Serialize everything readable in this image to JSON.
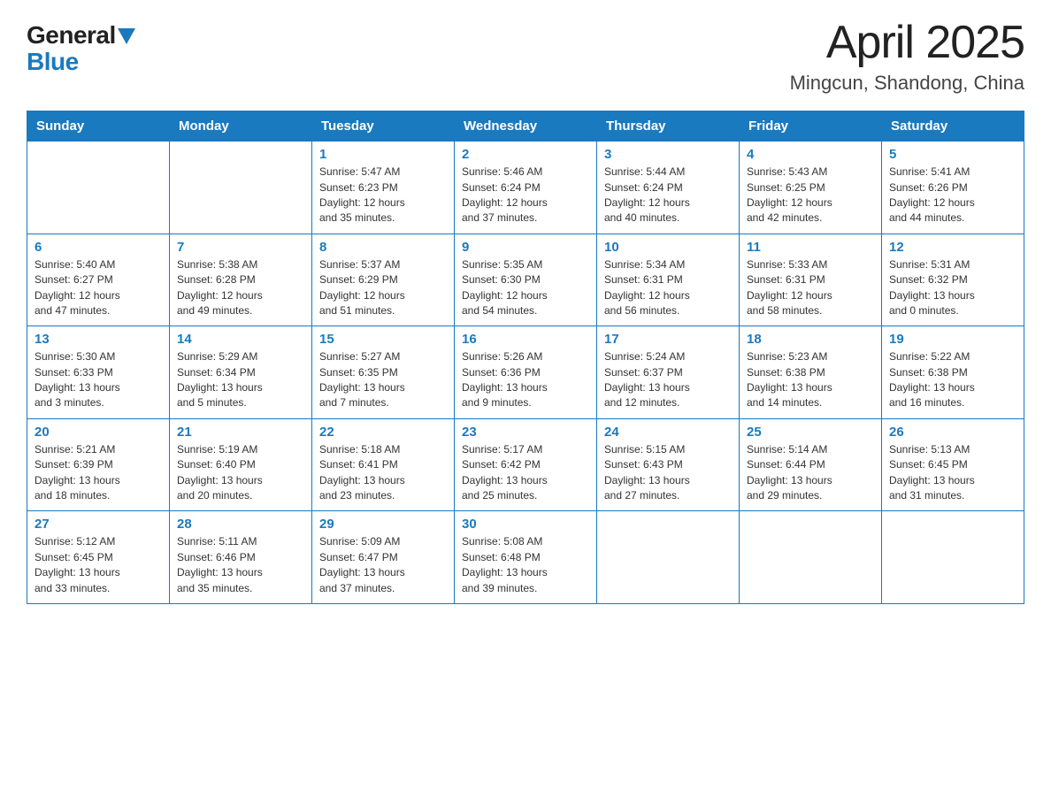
{
  "logo": {
    "general": "General",
    "blue": "Blue"
  },
  "title": "April 2025",
  "subtitle": "Mingcun, Shandong, China",
  "headers": [
    "Sunday",
    "Monday",
    "Tuesday",
    "Wednesday",
    "Thursday",
    "Friday",
    "Saturday"
  ],
  "weeks": [
    [
      {
        "day": "",
        "info": ""
      },
      {
        "day": "",
        "info": ""
      },
      {
        "day": "1",
        "info": "Sunrise: 5:47 AM\nSunset: 6:23 PM\nDaylight: 12 hours\nand 35 minutes."
      },
      {
        "day": "2",
        "info": "Sunrise: 5:46 AM\nSunset: 6:24 PM\nDaylight: 12 hours\nand 37 minutes."
      },
      {
        "day": "3",
        "info": "Sunrise: 5:44 AM\nSunset: 6:24 PM\nDaylight: 12 hours\nand 40 minutes."
      },
      {
        "day": "4",
        "info": "Sunrise: 5:43 AM\nSunset: 6:25 PM\nDaylight: 12 hours\nand 42 minutes."
      },
      {
        "day": "5",
        "info": "Sunrise: 5:41 AM\nSunset: 6:26 PM\nDaylight: 12 hours\nand 44 minutes."
      }
    ],
    [
      {
        "day": "6",
        "info": "Sunrise: 5:40 AM\nSunset: 6:27 PM\nDaylight: 12 hours\nand 47 minutes."
      },
      {
        "day": "7",
        "info": "Sunrise: 5:38 AM\nSunset: 6:28 PM\nDaylight: 12 hours\nand 49 minutes."
      },
      {
        "day": "8",
        "info": "Sunrise: 5:37 AM\nSunset: 6:29 PM\nDaylight: 12 hours\nand 51 minutes."
      },
      {
        "day": "9",
        "info": "Sunrise: 5:35 AM\nSunset: 6:30 PM\nDaylight: 12 hours\nand 54 minutes."
      },
      {
        "day": "10",
        "info": "Sunrise: 5:34 AM\nSunset: 6:31 PM\nDaylight: 12 hours\nand 56 minutes."
      },
      {
        "day": "11",
        "info": "Sunrise: 5:33 AM\nSunset: 6:31 PM\nDaylight: 12 hours\nand 58 minutes."
      },
      {
        "day": "12",
        "info": "Sunrise: 5:31 AM\nSunset: 6:32 PM\nDaylight: 13 hours\nand 0 minutes."
      }
    ],
    [
      {
        "day": "13",
        "info": "Sunrise: 5:30 AM\nSunset: 6:33 PM\nDaylight: 13 hours\nand 3 minutes."
      },
      {
        "day": "14",
        "info": "Sunrise: 5:29 AM\nSunset: 6:34 PM\nDaylight: 13 hours\nand 5 minutes."
      },
      {
        "day": "15",
        "info": "Sunrise: 5:27 AM\nSunset: 6:35 PM\nDaylight: 13 hours\nand 7 minutes."
      },
      {
        "day": "16",
        "info": "Sunrise: 5:26 AM\nSunset: 6:36 PM\nDaylight: 13 hours\nand 9 minutes."
      },
      {
        "day": "17",
        "info": "Sunrise: 5:24 AM\nSunset: 6:37 PM\nDaylight: 13 hours\nand 12 minutes."
      },
      {
        "day": "18",
        "info": "Sunrise: 5:23 AM\nSunset: 6:38 PM\nDaylight: 13 hours\nand 14 minutes."
      },
      {
        "day": "19",
        "info": "Sunrise: 5:22 AM\nSunset: 6:38 PM\nDaylight: 13 hours\nand 16 minutes."
      }
    ],
    [
      {
        "day": "20",
        "info": "Sunrise: 5:21 AM\nSunset: 6:39 PM\nDaylight: 13 hours\nand 18 minutes."
      },
      {
        "day": "21",
        "info": "Sunrise: 5:19 AM\nSunset: 6:40 PM\nDaylight: 13 hours\nand 20 minutes."
      },
      {
        "day": "22",
        "info": "Sunrise: 5:18 AM\nSunset: 6:41 PM\nDaylight: 13 hours\nand 23 minutes."
      },
      {
        "day": "23",
        "info": "Sunrise: 5:17 AM\nSunset: 6:42 PM\nDaylight: 13 hours\nand 25 minutes."
      },
      {
        "day": "24",
        "info": "Sunrise: 5:15 AM\nSunset: 6:43 PM\nDaylight: 13 hours\nand 27 minutes."
      },
      {
        "day": "25",
        "info": "Sunrise: 5:14 AM\nSunset: 6:44 PM\nDaylight: 13 hours\nand 29 minutes."
      },
      {
        "day": "26",
        "info": "Sunrise: 5:13 AM\nSunset: 6:45 PM\nDaylight: 13 hours\nand 31 minutes."
      }
    ],
    [
      {
        "day": "27",
        "info": "Sunrise: 5:12 AM\nSunset: 6:45 PM\nDaylight: 13 hours\nand 33 minutes."
      },
      {
        "day": "28",
        "info": "Sunrise: 5:11 AM\nSunset: 6:46 PM\nDaylight: 13 hours\nand 35 minutes."
      },
      {
        "day": "29",
        "info": "Sunrise: 5:09 AM\nSunset: 6:47 PM\nDaylight: 13 hours\nand 37 minutes."
      },
      {
        "day": "30",
        "info": "Sunrise: 5:08 AM\nSunset: 6:48 PM\nDaylight: 13 hours\nand 39 minutes."
      },
      {
        "day": "",
        "info": ""
      },
      {
        "day": "",
        "info": ""
      },
      {
        "day": "",
        "info": ""
      }
    ]
  ]
}
